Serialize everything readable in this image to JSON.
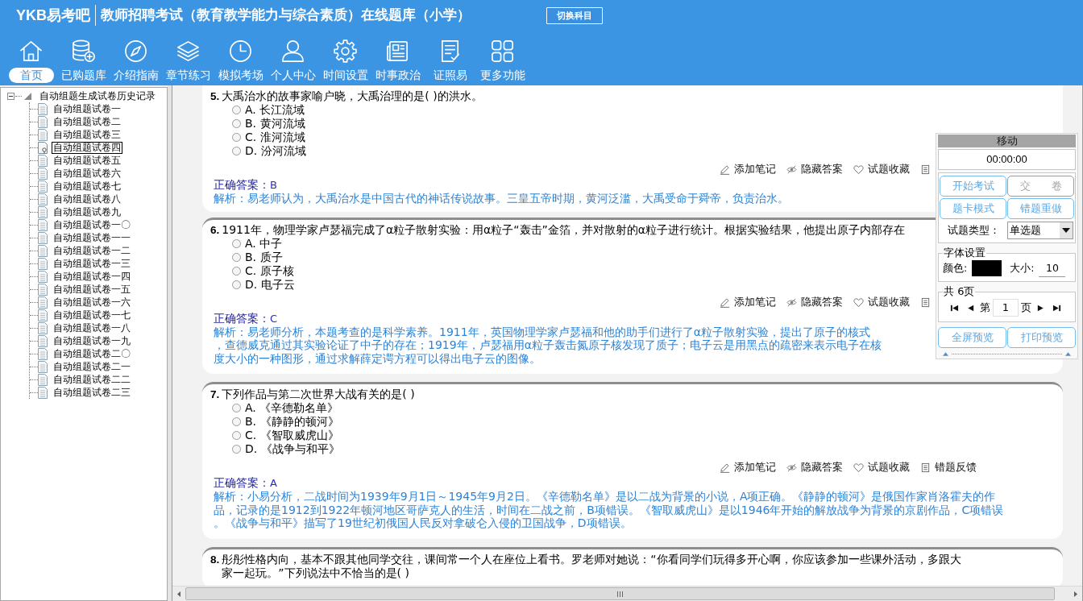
{
  "header": {
    "logo": "YKB易考吧",
    "title": "教师招聘考试（教育教学能力与综合素质）在线题库（小学）",
    "switch_button": "切换科目"
  },
  "toolbar": [
    {
      "label": "首页",
      "selected": true
    },
    {
      "label": "已购题库",
      "selected": false
    },
    {
      "label": "介绍指南",
      "selected": false
    },
    {
      "label": "章节练习",
      "selected": false
    },
    {
      "label": "模拟考场",
      "selected": false
    },
    {
      "label": "个人中心",
      "selected": false
    },
    {
      "label": "时间设置",
      "selected": false
    },
    {
      "label": "时事政治",
      "selected": false
    },
    {
      "label": "证照易",
      "selected": false
    },
    {
      "label": "更多功能",
      "selected": false
    }
  ],
  "tree": {
    "label": "自动组题生成试卷历史记录",
    "expanded": true,
    "children": [
      {
        "label": "自动组题试卷一",
        "selected": false
      },
      {
        "label": "自动组题试卷二",
        "selected": false
      },
      {
        "label": "自动组题试卷三",
        "selected": false
      },
      {
        "label": "自动组题试卷四",
        "selected": true
      },
      {
        "label": "自动组题试卷五",
        "selected": false
      },
      {
        "label": "自动组题试卷六",
        "selected": false
      },
      {
        "label": "自动组题试卷七",
        "selected": false
      },
      {
        "label": "自动组题试卷八",
        "selected": false
      },
      {
        "label": "自动组题试卷九",
        "selected": false
      },
      {
        "label": "自动组题试卷一〇",
        "selected": false
      },
      {
        "label": "自动组题试卷一一",
        "selected": false
      },
      {
        "label": "自动组题试卷一二",
        "selected": false
      },
      {
        "label": "自动组题试卷一三",
        "selected": false
      },
      {
        "label": "自动组题试卷一四",
        "selected": false
      },
      {
        "label": "自动组题试卷一五",
        "selected": false
      },
      {
        "label": "自动组题试卷一六",
        "selected": false
      },
      {
        "label": "自动组题试卷一七",
        "selected": false
      },
      {
        "label": "自动组题试卷一八",
        "selected": false
      },
      {
        "label": "自动组题试卷一九",
        "selected": false
      },
      {
        "label": "自动组题试卷二〇",
        "selected": false
      },
      {
        "label": "自动组题试卷二一",
        "selected": false
      },
      {
        "label": "自动组题试卷二二",
        "selected": false
      },
      {
        "label": "自动组题试卷二三",
        "selected": false
      }
    ]
  },
  "questions": [
    {
      "number": "5.",
      "lines": [
        "大禹治水的故事家喻户晓，大禹治理的是( )的洪水。"
      ],
      "options": [
        {
          "text": "A. 长江流域",
          "selected": false
        },
        {
          "text": "B. 黄河流域",
          "selected": false
        },
        {
          "text": "C. 淮河流域",
          "selected": false
        },
        {
          "text": "D. 汾河流域",
          "selected": false
        }
      ],
      "actions": [
        {
          "kind": "note",
          "label": "添加笔记"
        },
        {
          "kind": "hide",
          "label": "隐藏答案"
        },
        {
          "kind": "favorite",
          "label": "试题收藏"
        },
        {
          "kind": "feedback"
        }
      ],
      "answer_label": "正确答案：",
      "answer": "B",
      "analysis": [
        "解析：易老师认为，大禹治水是中国古代的神话传说故事。三皇五帝时期，黄河泛滥，大禹受命于舜帝，负责治水。"
      ]
    },
    {
      "number": "6.",
      "lines": [
        "1911年，物理学家卢瑟福完成了α粒子散射实验：用α粒子“轰击”金箔，并对散射的α粒子进行统计。根据实验结果，他提出原子内部存在"
      ],
      "options": [
        {
          "text": "A. 中子",
          "selected": false
        },
        {
          "text": "B. 质子",
          "selected": false
        },
        {
          "text": "C. 原子核",
          "selected": false
        },
        {
          "text": "D. 电子云",
          "selected": false
        }
      ],
      "actions": [
        {
          "kind": "note",
          "label": "添加笔记"
        },
        {
          "kind": "hide",
          "label": "隐藏答案"
        },
        {
          "kind": "favorite",
          "label": "试题收藏"
        },
        {
          "kind": "feedback"
        }
      ],
      "answer_label": "正确答案：",
      "answer": "C",
      "analysis": [
        "解析：易老师分析，本题考查的是科学素养。1911年，英国物理学家卢瑟福和他的助手们进行了α粒子散射实验，提出了原子的核式",
        "，查德威克通过其实验论证了中子的存在；1919年，卢瑟福用α粒子轰击氮原子核发现了质子；电子云是用黑点的疏密来表示电子在核",
        "度大小的一种图形，通过求解薛定谔方程可以得出电子云的图像。"
      ]
    },
    {
      "number": "7.",
      "lines": [
        "下列作品与第二次世界大战有关的是( )"
      ],
      "options": [
        {
          "text": "A. 《辛德勒名单》",
          "selected": false
        },
        {
          "text": "B. 《静静的顿河》",
          "selected": false
        },
        {
          "text": "C. 《智取威虎山》",
          "selected": false
        },
        {
          "text": "D. 《战争与和平》",
          "selected": false
        }
      ],
      "actions": [
        {
          "kind": "note",
          "label": "添加笔记"
        },
        {
          "kind": "hide",
          "label": "隐藏答案"
        },
        {
          "kind": "favorite",
          "label": "试题收藏"
        },
        {
          "kind": "feedback",
          "label": "错题反馈"
        }
      ],
      "answer_label": "正确答案：",
      "answer": "A",
      "analysis": [
        "解析：小易分析，二战时间为1939年9月1日～1945年9月2日。《辛德勒名单》是以二战为背景的小说，A项正确。《静静的顿河》是俄国作家肖洛霍夫的作",
        "品，记录的是1912到1922年顿河地区哥萨克人的生活，时间在二战之前，B项错误。《智取威虎山》是以1946年开始的解放战争为背景的京剧作品，C项错误",
        "。《战争与和平》描写了19世纪初俄国人民反对拿破仑入侵的卫国战争，D项错误。"
      ]
    },
    {
      "number": "8.",
      "lines": [
        "彤彤性格内向，基本不跟其他同学交往，课间常一个人在座位上看书。罗老师对她说：“你看同学们玩得多开心啊，你应该参加一些课外活动，多跟大",
        "家一起玩。”下列说法中不恰当的是( )"
      ]
    }
  ],
  "side_panel": {
    "title": "移动",
    "timer": "00:00:00",
    "buttons": [
      {
        "label": "开始考试",
        "disabled": false
      },
      {
        "label": "交　　卷",
        "disabled": true
      },
      {
        "label": "题卡模式",
        "disabled": false
      },
      {
        "label": "错题重做",
        "disabled": false
      }
    ],
    "question_type": {
      "label": "试题类型：",
      "value": "单选题"
    },
    "font_settings": {
      "title": "字体设置",
      "color_label": "颜色:",
      "color": "#000000",
      "size_label": "大小:",
      "size": "10"
    },
    "pager": {
      "title": "共 6页",
      "prefix": "第",
      "page": "1",
      "suffix": "页"
    },
    "preview_buttons": [
      {
        "label": "全屏预览"
      },
      {
        "label": "打印预览"
      }
    ]
  }
}
